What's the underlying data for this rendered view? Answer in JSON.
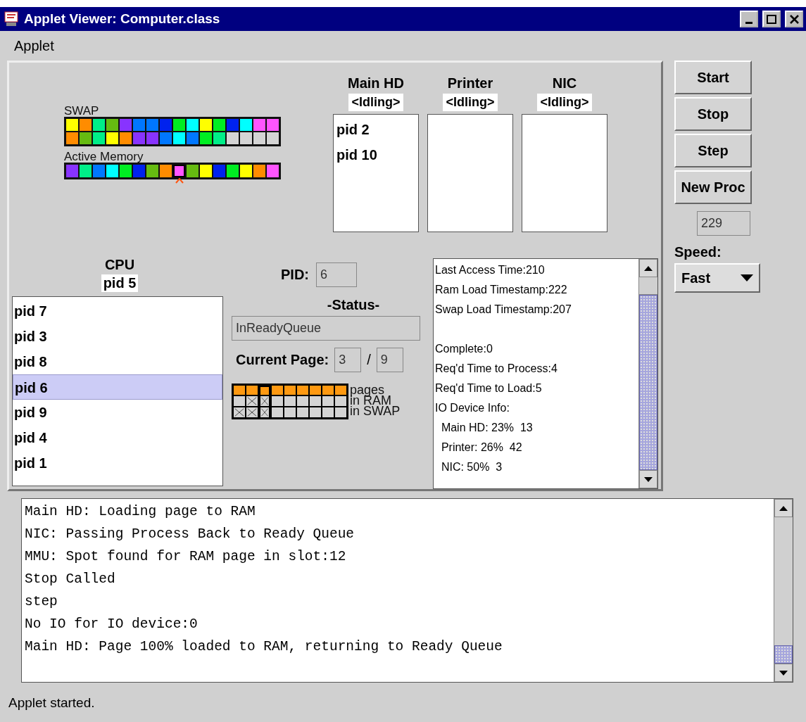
{
  "window": {
    "title": "Applet Viewer: Computer.class"
  },
  "menu": [
    "Applet"
  ],
  "memory": {
    "swap_label": "SWAP",
    "swap_rows": [
      [
        {
          "kind": "page",
          "color": "#ffff00"
        },
        {
          "kind": "page",
          "color": "#ff8c00"
        },
        {
          "kind": "page",
          "color": "#00ee88"
        },
        {
          "kind": "page",
          "color": "#66bb11"
        },
        {
          "kind": "page",
          "color": "#8833ff"
        },
        {
          "kind": "page",
          "color": "#0077ff"
        },
        {
          "kind": "page",
          "color": "#0077ff"
        },
        {
          "kind": "page",
          "color": "#0022ee"
        },
        {
          "kind": "page",
          "color": "#00ee22"
        },
        {
          "kind": "page",
          "color": "#00ffff"
        },
        {
          "kind": "page",
          "color": "#ffff00"
        },
        {
          "kind": "page",
          "color": "#00ee22"
        },
        {
          "kind": "page",
          "color": "#0022ee"
        },
        {
          "kind": "page",
          "color": "#00ffff"
        },
        {
          "kind": "page",
          "color": "#ff55ff"
        },
        {
          "kind": "page",
          "color": "#ff55ff"
        }
      ],
      [
        {
          "kind": "page",
          "color": "#ff8c00"
        },
        {
          "kind": "page",
          "color": "#66bb11"
        },
        {
          "kind": "page",
          "color": "#00ee88"
        },
        {
          "kind": "page",
          "color": "#ffff00"
        },
        {
          "kind": "page",
          "color": "#ff8c00"
        },
        {
          "kind": "page",
          "color": "#8833ff"
        },
        {
          "kind": "page",
          "color": "#8833ff"
        },
        {
          "kind": "page",
          "color": "#0077ff"
        },
        {
          "kind": "page",
          "color": "#00ffff"
        },
        {
          "kind": "page",
          "color": "#0077ff"
        },
        {
          "kind": "page",
          "color": "#00ee22"
        },
        {
          "kind": "page",
          "color": "#00ee88"
        },
        {
          "kind": "empty"
        },
        {
          "kind": "empty"
        },
        {
          "kind": "empty"
        },
        {
          "kind": "empty"
        }
      ]
    ],
    "active_label": "Active Memory",
    "active": [
      {
        "color": "#8833ff",
        "selected": false
      },
      {
        "color": "#00ee88",
        "selected": false
      },
      {
        "color": "#0077ff",
        "selected": false
      },
      {
        "color": "#00ffff",
        "selected": false
      },
      {
        "color": "#00ee22",
        "selected": false
      },
      {
        "color": "#0022ee",
        "selected": false
      },
      {
        "color": "#66bb11",
        "selected": false
      },
      {
        "color": "#ff8c00",
        "selected": false
      },
      {
        "color": "#ff55ff",
        "selected": true
      },
      {
        "color": "#66bb11",
        "selected": false
      },
      {
        "color": "#ffff00",
        "selected": false
      },
      {
        "color": "#0022ee",
        "selected": false
      },
      {
        "color": "#00ee22",
        "selected": false
      },
      {
        "color": "#ffff00",
        "selected": false
      },
      {
        "color": "#ff8c00",
        "selected": false
      },
      {
        "color": "#ff55ff",
        "selected": false
      }
    ]
  },
  "devices": [
    {
      "name": "Main HD",
      "status": "<Idling>",
      "queue": [
        "pid 2",
        "pid 10"
      ]
    },
    {
      "name": "Printer",
      "status": "<Idling>"
    },
    {
      "name": "NIC",
      "status": "<Idling>"
    }
  ],
  "cpu": {
    "label": "CPU",
    "current": "pid 5",
    "ready_queue": [
      {
        "label": "pid 7",
        "selected": false
      },
      {
        "label": "pid 3",
        "selected": false
      },
      {
        "label": "pid 8",
        "selected": false
      },
      {
        "label": "pid 6",
        "selected": true
      },
      {
        "label": "pid 9",
        "selected": false
      },
      {
        "label": "pid 4",
        "selected": false
      },
      {
        "label": "pid 1",
        "selected": false
      }
    ]
  },
  "process": {
    "pid_label": "PID:",
    "pid": "6",
    "status_heading": "-Status-",
    "status": "InReadyQueue",
    "page_label": "Current Page:",
    "page": "3",
    "page_sep": "/",
    "page_count": "9",
    "page_table": [
      {
        "selected": false,
        "in_ram": false,
        "in_swap": true
      },
      {
        "selected": false,
        "in_ram": true,
        "in_swap": true
      },
      {
        "selected": true,
        "in_ram": true,
        "in_swap": true
      },
      {
        "selected": false,
        "in_ram": false,
        "in_swap": false
      },
      {
        "selected": false,
        "in_ram": false,
        "in_swap": false
      },
      {
        "selected": false,
        "in_ram": false,
        "in_swap": false
      },
      {
        "selected": false,
        "in_ram": false,
        "in_swap": false
      },
      {
        "selected": false,
        "in_ram": false,
        "in_swap": false
      },
      {
        "selected": false,
        "in_ram": false,
        "in_swap": false
      }
    ],
    "legend": [
      "pages",
      "in RAM",
      "in SWAP"
    ],
    "info": [
      [
        "Last Access Time:210",
        "Ram Load Timestamp:222",
        "Swap Load Timestamp:207"
      ],
      [
        "Complete:0",
        "Req'd Time to Process:4",
        "Req'd Time to Load:5",
        "IO Device Info:",
        "  Main HD: 23%  13",
        "  Printer: 26%  42",
        "  NIC: 50%  3"
      ]
    ]
  },
  "controls": {
    "buttons": [
      "Start",
      "Stop",
      "Step",
      "New Proc"
    ],
    "counter": "229",
    "speed_label": "Speed:",
    "speed": "Fast"
  },
  "log": [
    "Main HD: Loading page to RAM",
    "NIC: Passing Process Back to Ready Queue",
    "MMU: Spot found for RAM page in slot:12",
    "Stop Called",
    "step",
    "No IO for IO device:0",
    "Main HD: Page 100% loaded to RAM, returning to Ready Queue"
  ],
  "status_bar": "Applet started."
}
